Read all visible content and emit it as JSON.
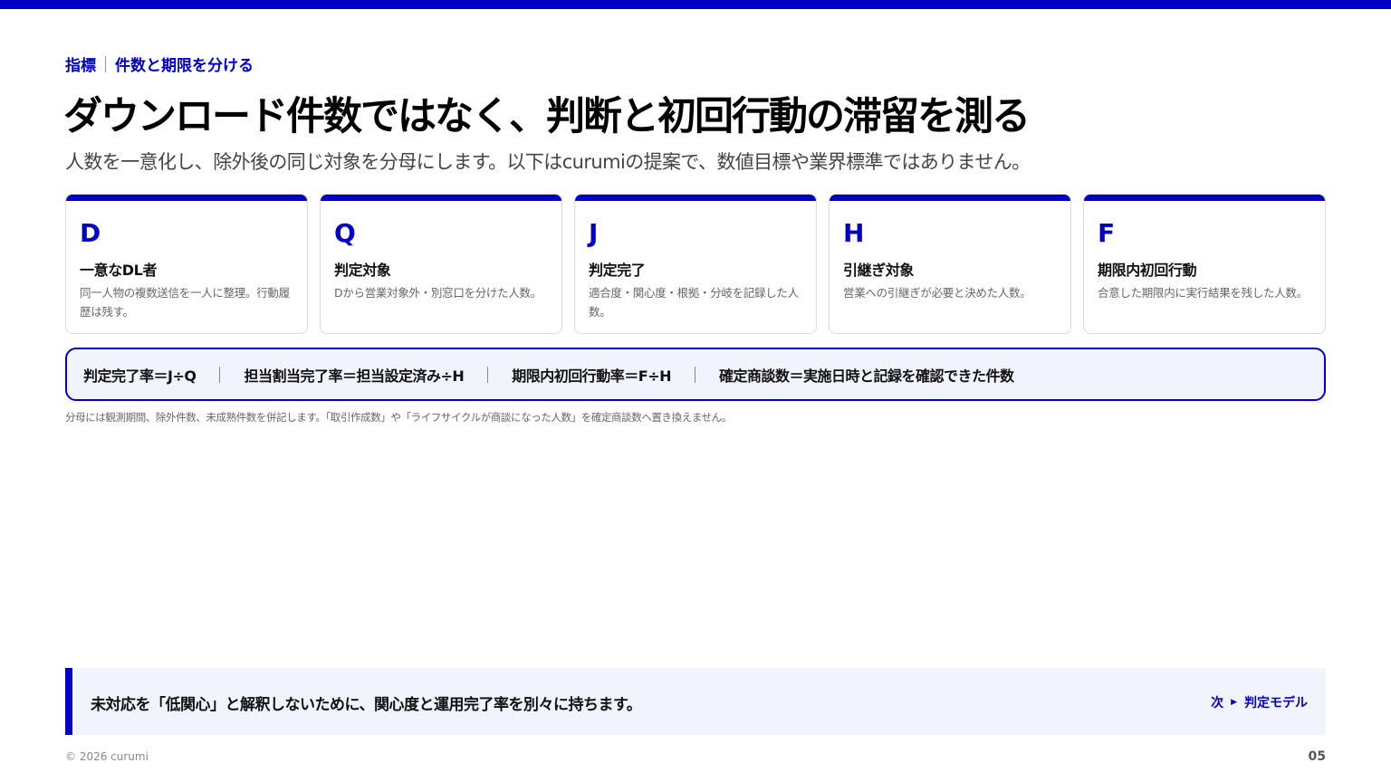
{
  "header": {
    "kicker_left": "指標",
    "kicker_right": "件数と期限を分ける",
    "title": "ダウンロード件数ではなく、判断と初回行動の滞留を測る",
    "subtitle": "人数を一意化し、除外後の同じ対象を分母にします。以下はcurumiの提案で、数値目標や業界標準ではありません。"
  },
  "cards": [
    {
      "letter": "D",
      "name": "一意なDL者",
      "desc": "同一人物の複数送信を一人に整理。行動履歴は残す。"
    },
    {
      "letter": "Q",
      "name": "判定対象",
      "desc": "Dから営業対象外・別窓口を分けた人数。"
    },
    {
      "letter": "J",
      "name": "判定完了",
      "desc": "適合度・関心度・根拠・分岐を記録した人数。"
    },
    {
      "letter": "H",
      "name": "引継ぎ対象",
      "desc": "営業への引継ぎが必要と決めた人数。"
    },
    {
      "letter": "F",
      "name": "期限内初回行動",
      "desc": "合意した期限内に実行結果を残した人数。"
    }
  ],
  "formulas": [
    "判定完了率＝J÷Q",
    "担当割当完了率＝担当設定済み÷H",
    "期限内初回行動率＝F÷H",
    "確定商談数＝実施日時と記録を確認できた件数"
  ],
  "footnote": "分母には観測期間、除外件数、未成熟件数を併記します。「取引作成数」や「ライフサイクルが商談になった人数」を確定商談数へ置き換えません。",
  "callout": {
    "text": "未対応を「低関心」と解釈しないために、関心度と運用完了率を別々に持ちます。",
    "next_label": "次",
    "next_target": "判定モデル"
  },
  "footer": {
    "copyright": "© 2026 curumi",
    "page_number": "05"
  },
  "colors": {
    "accent": "#0000c8",
    "panel_bg": "#f1f4fd"
  }
}
